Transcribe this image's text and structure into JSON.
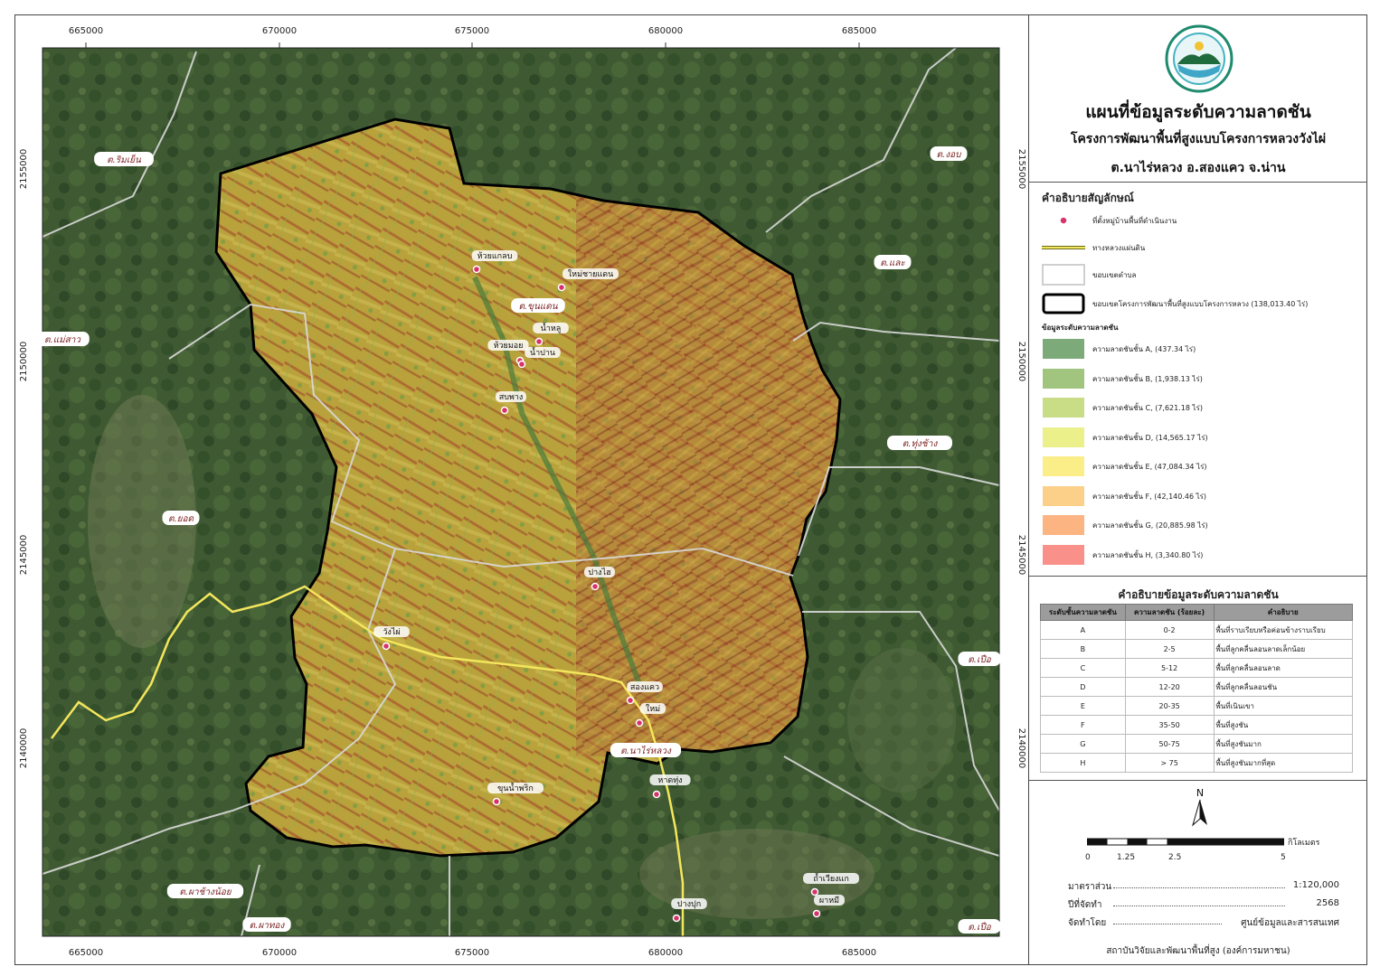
{
  "title": "แผนที่ข้อมูลระดับความลาดชัน",
  "subtitle": "โครงการพัฒนาพื้นที่สูงแบบโครงการหลวงวังไผ่",
  "location": "ต.นาไร่หลวง อ.สองแคว จ.น่าน",
  "logo": {
    "icon": "hrdi-logo-icon"
  },
  "coords": {
    "x_ticks": [
      "665000",
      "670000",
      "675000",
      "680000",
      "685000"
    ],
    "y_ticks": [
      "2155000",
      "2150000",
      "2145000",
      "2140000"
    ]
  },
  "subdistricts": [
    {
      "name": "ต.ริมเย็น"
    },
    {
      "name": "ต.งอบ"
    },
    {
      "name": "ต.และ"
    },
    {
      "name": "ต.แม่สาว"
    },
    {
      "name": "ต.ขุนแดน"
    },
    {
      "name": "ต.ทุ่งช้าง"
    },
    {
      "name": "ต.ยอด"
    },
    {
      "name": "ต.เปือ"
    },
    {
      "name": "ต.นาไร่หลวง"
    },
    {
      "name": "ต.ผาช้างน้อย"
    },
    {
      "name": "ต.ผาทอง"
    },
    {
      "name": "ต.เปือ"
    }
  ],
  "villages": [
    {
      "name": "ห้วยแกลบ"
    },
    {
      "name": "ใหม่ชายแดน"
    },
    {
      "name": "น้ำหลู"
    },
    {
      "name": "ห้วยมอย"
    },
    {
      "name": "น้ำปาน"
    },
    {
      "name": "สบพาง"
    },
    {
      "name": "ปางไฮ"
    },
    {
      "name": "วังไผ่"
    },
    {
      "name": "สองแคว"
    },
    {
      "name": "ใหม่"
    },
    {
      "name": "หาดทุ่ง"
    },
    {
      "name": "ขุนน้ำพริก"
    },
    {
      "name": "ปางปุก"
    },
    {
      "name": "ถ้ำเวียงแก"
    },
    {
      "name": "ผาหมี"
    }
  ],
  "legend": {
    "title": "คำอธิบายสัญลักษณ์",
    "items": [
      {
        "label": "ที่ตั้งหมู่บ้านพื้นที่ดำเนินงาน"
      },
      {
        "label": "ทางหลวงแผ่นดิน"
      },
      {
        "label": "ขอบเขตตำบล"
      },
      {
        "label": "ขอบเขตโครงการพัฒนาพื้นที่สูงแบบโครงการหลวง (138,013.40 ไร่)"
      }
    ],
    "slope_heading": "ข้อมูลระดับความลาดชัน",
    "slope_classes": [
      {
        "label": "ความลาดชันชั้น  A, (437.34 ไร่)",
        "color": "#7daa79"
      },
      {
        "label": "ความลาดชันชั้น  B, (1,938.13 ไร่)",
        "color": "#a1c47e"
      },
      {
        "label": "ความลาดชันชั้น  C, (7,621.18 ไร่)",
        "color": "#c9dc86"
      },
      {
        "label": "ความลาดชันชั้น  D, (14,565.17 ไร่)",
        "color": "#ebf08b"
      },
      {
        "label": "ความลาดชันชั้น  E, (47,084.34 ไร่)",
        "color": "#fbee88"
      },
      {
        "label": "ความลาดชันชั้น  F, (42,140.46 ไร่)",
        "color": "#fcd089"
      },
      {
        "label": "ความลาดชันชั้น  G, (20,885.98 ไร่)",
        "color": "#fbb482"
      },
      {
        "label": "ความลาดชันชั้น  H, (3,340.80 ไร่)",
        "color": "#f9918a"
      }
    ]
  },
  "slope_table": {
    "title": "คำอธิบายข้อมูลระดับความลาดชัน",
    "headers": [
      "ระดับชั้นความลาดชัน",
      "ความลาดชัน (ร้อยละ)",
      "คำอธิบาย"
    ],
    "rows": [
      {
        "cls": "A",
        "range": "0-2",
        "desc": "พื้นที่ราบเรียบหรือค่อนข้างราบเรียบ"
      },
      {
        "cls": "B",
        "range": "2-5",
        "desc": "พื้นที่ลูกคลื่นลอนลาดเล็กน้อย"
      },
      {
        "cls": "C",
        "range": "5-12",
        "desc": "พื้นที่ลูกคลื่นลอนลาด"
      },
      {
        "cls": "D",
        "range": "12-20",
        "desc": "พื้นที่ลูกคลื่นลอนชัน"
      },
      {
        "cls": "E",
        "range": "20-35",
        "desc": "พื้นที่เนินเขา"
      },
      {
        "cls": "F",
        "range": "35-50",
        "desc": "พื้นที่สูงชัน"
      },
      {
        "cls": "G",
        "range": "50-75",
        "desc": "พื้นที่สูงชันมาก"
      },
      {
        "cls": "H",
        "range": "> 75",
        "desc": "พื้นที่สูงชันมากที่สุด"
      }
    ]
  },
  "north": {
    "label": "N"
  },
  "scalebar": {
    "ticks": [
      "0",
      "1.25",
      "2.5",
      "5"
    ],
    "unit": "กิโลเมตร"
  },
  "info": {
    "scale_label": "มาตราส่วน",
    "scale_value": "1:120,000",
    "year_label": "ปีที่จัดทำ",
    "year_value": "2568",
    "by_label": "จัดทำโดย",
    "by_value": "ศูนย์ข้อมูลและสารสนเทศ"
  },
  "footer": "สถาบันวิจัยและพัฒนาพื้นที่สูง (องค์การมหาชน)"
}
